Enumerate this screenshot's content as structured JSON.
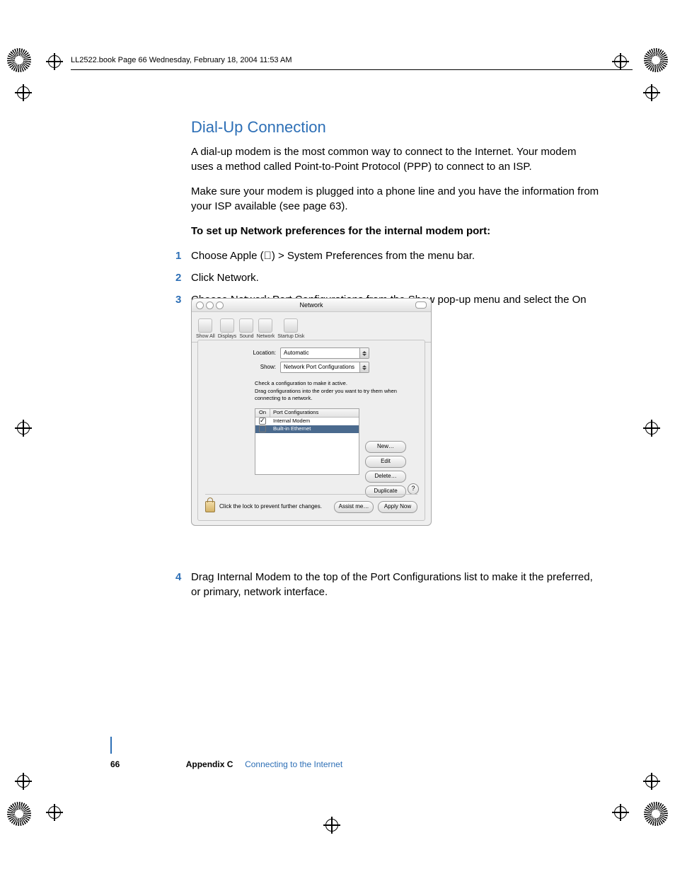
{
  "header": {
    "line": "LL2522.book  Page 66  Wednesday, February 18, 2004  11:53 AM"
  },
  "body": {
    "heading": "Dial-Up Connection",
    "p1": "A dial-up modem is the most common way to connect to the Internet. Your modem uses a method called Point-to-Point Protocol (PPP) to connect to an ISP.",
    "p2": "Make sure your modem is plugged into a phone line and you have the information from your ISP available (see page 63).",
    "boldline": "To set up Network preferences for the internal modem port:",
    "step1": "Choose Apple () > System Preferences from the menu bar.",
    "step2": "Click Network.",
    "step3": "Choose Network Port Configurations from the Show pop-up menu and select the On checkbox next to Internal Modem.",
    "step4": "Drag Internal Modem to the top of the Port Configurations list to make it the preferred, or primary, network interface."
  },
  "window": {
    "title": "Network",
    "toolbar": [
      "Show All",
      "Displays",
      "Sound",
      "Network",
      "Startup Disk"
    ],
    "location_label": "Location:",
    "location_value": "Automatic",
    "show_label": "Show:",
    "show_value": "Network Port Configurations",
    "hint1": "Check a configuration to make it active.",
    "hint2": "Drag configurations into the order you want to try them when connecting to a network.",
    "col_on": "On",
    "col_name": "Port Configurations",
    "rows": [
      {
        "on": true,
        "name": "Internal Modem",
        "selected": false
      },
      {
        "on": false,
        "name": "Built-in Ethernet",
        "selected": true
      }
    ],
    "buttons": {
      "new": "New…",
      "edit": "Edit",
      "delete": "Delete…",
      "duplicate": "Duplicate"
    },
    "lock_text": "Click the lock to prevent further changes.",
    "assist": "Assist me…",
    "apply": "Apply Now",
    "help": "?"
  },
  "footer": {
    "page": "66",
    "appendix": "Appendix C",
    "title": "Connecting to the Internet"
  }
}
